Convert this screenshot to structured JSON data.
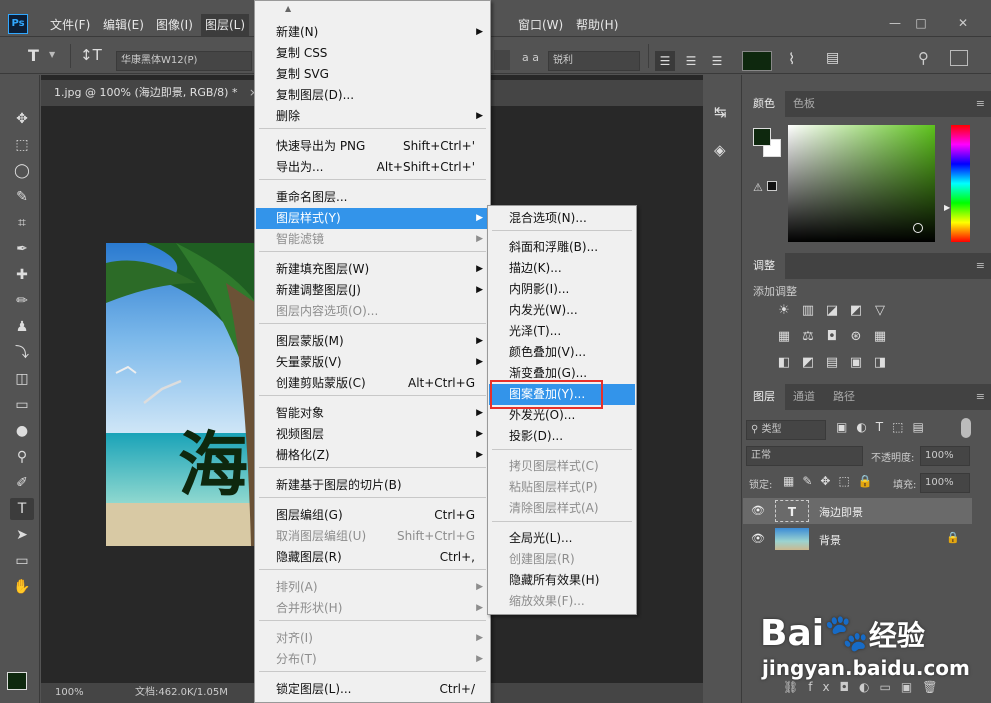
{
  "menubar": {
    "logo": "Ps",
    "items": [
      "文件(F)",
      "编辑(E)",
      "图像(I)",
      "图层(L)",
      "窗口(W)",
      "帮助(H)"
    ],
    "win_min": "—",
    "win_max": "□",
    "win_close": "✕"
  },
  "options": {
    "font": "华康黑体W12(P)",
    "aa_label": "a a",
    "aa_value": "锐利",
    "color": "#0e280e"
  },
  "document": {
    "tab": "1.jpg @ 100% (海边即景, RGB/8) *",
    "tab_close": "×",
    "zoom": "100%",
    "docsize": "文档:462.0K/1.05M",
    "headline": "海"
  },
  "tools": [
    "✥",
    "⬚",
    "◯",
    "✎",
    "⌗",
    "✒",
    "✚",
    "✏",
    "♟",
    "⤵",
    "◫",
    "▭",
    "●",
    "⚲",
    "✐",
    "T",
    "➤",
    "▭",
    "✋",
    "⚲",
    "•••"
  ],
  "layer_menu": {
    "items": [
      {
        "label": "新建(N)",
        "arrow": true
      },
      {
        "label": "复制 CSS"
      },
      {
        "label": "复制 SVG"
      },
      {
        "label": "复制图层(D)..."
      },
      {
        "label": "删除",
        "arrow": true
      },
      {
        "label": "快速导出为 PNG",
        "shortcut": "Shift+Ctrl+'"
      },
      {
        "label": "导出为...",
        "shortcut": "Alt+Shift+Ctrl+'"
      },
      {
        "label": "重命名图层..."
      },
      {
        "label": "图层样式(Y)",
        "arrow": true
      },
      {
        "label": "智能滤镜",
        "arrow": true
      },
      {
        "label": "新建填充图层(W)",
        "arrow": true
      },
      {
        "label": "新建调整图层(J)",
        "arrow": true
      },
      {
        "label": "图层内容选项(O)..."
      },
      {
        "label": "图层蒙版(M)",
        "arrow": true
      },
      {
        "label": "矢量蒙版(V)",
        "arrow": true
      },
      {
        "label": "创建剪贴蒙版(C)",
        "shortcut": "Alt+Ctrl+G"
      },
      {
        "label": "智能对象",
        "arrow": true
      },
      {
        "label": "视频图层",
        "arrow": true
      },
      {
        "label": "栅格化(Z)",
        "arrow": true
      },
      {
        "label": "新建基于图层的切片(B)"
      },
      {
        "label": "图层编组(G)",
        "shortcut": "Ctrl+G"
      },
      {
        "label": "取消图层编组(U)",
        "shortcut": "Shift+Ctrl+G"
      },
      {
        "label": "隐藏图层(R)",
        "shortcut": "Ctrl+,"
      },
      {
        "label": "排列(A)",
        "arrow": true
      },
      {
        "label": "合并形状(H)",
        "arrow": true
      },
      {
        "label": "对齐(I)",
        "arrow": true
      },
      {
        "label": "分布(T)",
        "arrow": true
      },
      {
        "label": "锁定图层(L)...",
        "shortcut": "Ctrl+/"
      }
    ]
  },
  "style_menu": {
    "items": [
      {
        "label": "混合选项(N)..."
      },
      {
        "label": "斜面和浮雕(B)..."
      },
      {
        "label": "描边(K)..."
      },
      {
        "label": "内阴影(I)..."
      },
      {
        "label": "内发光(W)..."
      },
      {
        "label": "光泽(T)..."
      },
      {
        "label": "颜色叠加(V)..."
      },
      {
        "label": "渐变叠加(G)..."
      },
      {
        "label": "图案叠加(Y)..."
      },
      {
        "label": "外发光(O)..."
      },
      {
        "label": "投影(D)..."
      },
      {
        "label": "拷贝图层样式(C)"
      },
      {
        "label": "粘贴图层样式(P)"
      },
      {
        "label": "清除图层样式(A)"
      },
      {
        "label": "全局光(L)..."
      },
      {
        "label": "创建图层(R)"
      },
      {
        "label": "隐藏所有效果(H)"
      },
      {
        "label": "缩放效果(F)..."
      }
    ]
  },
  "color_panel": {
    "tab1": "颜色",
    "tab2": "色板",
    "fg": "#0e280e",
    "bg": "#ffffff"
  },
  "adj_panel": {
    "title": "调整",
    "subtitle": "添加调整",
    "row1": [
      "☀",
      "▥",
      "◪",
      "◩",
      "▽"
    ],
    "row2": [
      "▦",
      "⚖",
      "◘",
      "⊛",
      "▦"
    ],
    "row3": [
      "◧",
      "◩",
      "▤",
      "▣",
      "◨"
    ]
  },
  "layers_panel": {
    "tab1": "图层",
    "tab2": "通道",
    "tab3": "路径",
    "kind": "类型",
    "blend": "正常",
    "opacity_label": "不透明度:",
    "opacity": "100%",
    "lock_label": "锁定:",
    "fill_label": "填充:",
    "fill": "100%",
    "layer1": "海边即景",
    "layer2": "背景",
    "layer1_thumb": "T"
  },
  "watermark": {
    "logo": "Bai",
    "logo2": "du",
    "logo_cn": "经验",
    "url": "jingyan.baidu.com"
  }
}
